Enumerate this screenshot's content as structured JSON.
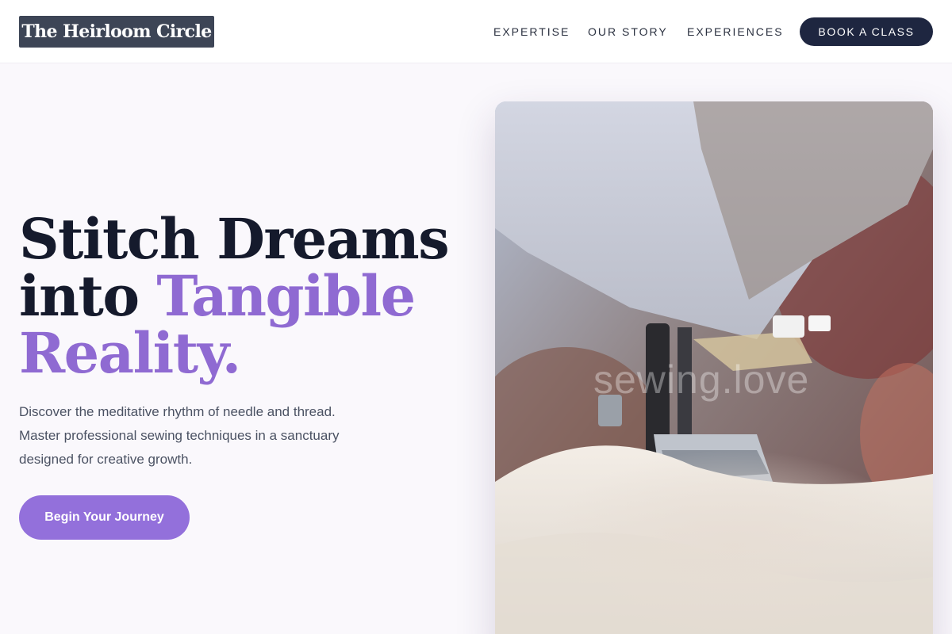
{
  "header": {
    "logo_text": "The Heirloom Circle",
    "nav": {
      "expertise": "EXPERTISE",
      "our_story": "OUR STORY",
      "experiences": "EXPERIENCES"
    },
    "book_button": "BOOK A CLASS"
  },
  "hero": {
    "headline_line1": "Stitch Dreams",
    "headline_line2_prefix": "into ",
    "headline_line2_accent": "Tangible",
    "headline_line3": "Reality.",
    "subtext": "Discover the meditative rhythm of needle and thread. Master professional sewing techniques in a sanctuary designed for creative growth.",
    "cta_label": "Begin Your Journey",
    "image_watermark": "sewing.love"
  },
  "colors": {
    "accent": "#9370db",
    "dark": "#1e2640",
    "logo_bg": "#3d4556"
  }
}
